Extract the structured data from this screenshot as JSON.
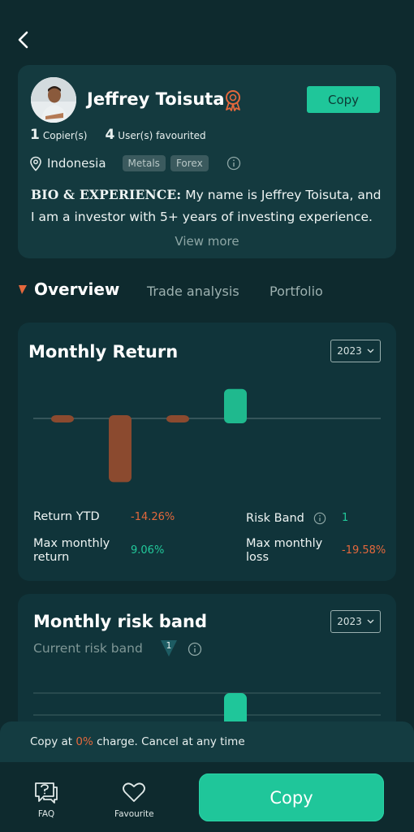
{
  "profile": {
    "name": "Jeffrey Toisuta",
    "copy_label": "Copy",
    "copiers_count": "1",
    "copiers_label": "Copier(s)",
    "favourited_count": "4",
    "favourited_label": "User(s) favourited",
    "location": "Indonesia",
    "tags": [
      "Metals",
      "Forex"
    ],
    "bio_heading": "BIO & EXPERIENCE:",
    "bio_text": " My name is Jeffrey Toisuta, and I am a investor with 5+ years of investing experience.",
    "view_more": "View more"
  },
  "tabs": {
    "active": "Overview",
    "items": [
      "Trade analysis",
      "Portfolio"
    ]
  },
  "monthly_return": {
    "title": "Monthly Return",
    "year": "2023",
    "return_ytd_label": "Return YTD",
    "return_ytd_value": "-14.26%",
    "risk_band_label": "Risk Band",
    "risk_band_value": "1",
    "max_monthly_return_label": "Max monthly return",
    "max_monthly_return_value": "9.06%",
    "max_monthly_loss_label": "Max monthly loss",
    "max_monthly_loss_value": "-19.58%"
  },
  "risk_band": {
    "title": "Monthly risk band",
    "year": "2023",
    "current_label": "Current risk band",
    "current_value": "1"
  },
  "banner": {
    "prefix": "Copy at ",
    "percent": "0%",
    "suffix": " charge. Cancel at any time"
  },
  "bottom_nav": {
    "faq": "FAQ",
    "favourite": "Favourite",
    "copy": "Copy"
  },
  "chart_data": {
    "type": "bar",
    "values": [
      -0.5,
      -19.58,
      -0.5,
      9.06
    ],
    "colors": {
      "negative": "#8b4a2f",
      "positive": "#1fb98e"
    }
  },
  "colors": {
    "accent": "#1fc69a",
    "negative": "#e4683c",
    "background": "#0e2a2e",
    "card": "#143a3f"
  }
}
